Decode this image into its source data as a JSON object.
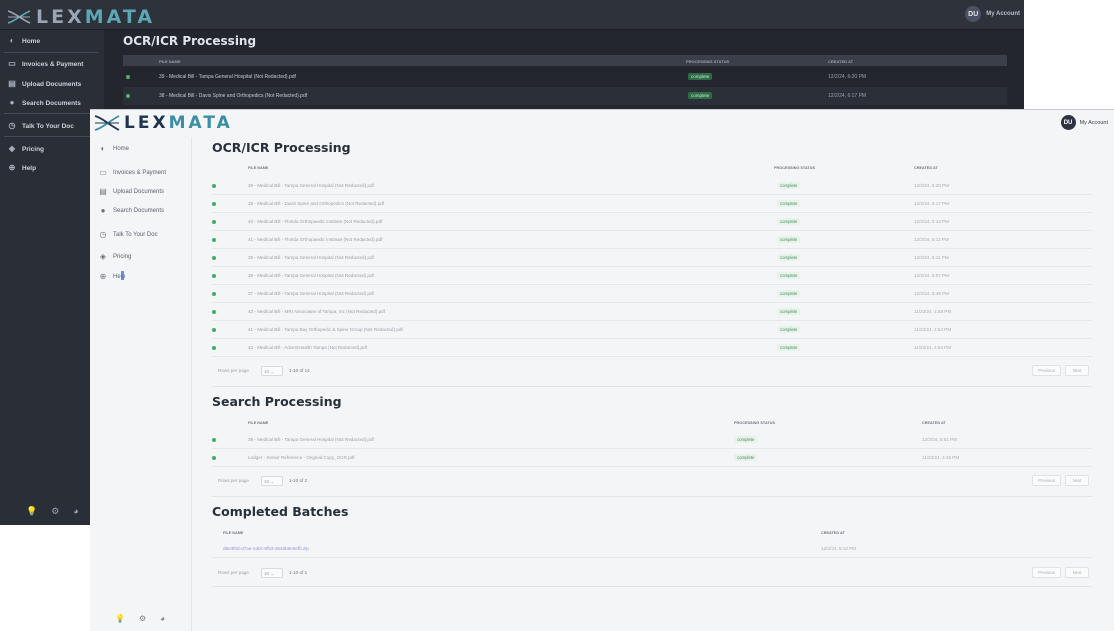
{
  "back": {
    "logo": {
      "prefix": "LEX",
      "accent": "MATA"
    },
    "account": {
      "initials": "DU",
      "label": "My Account"
    },
    "nav": [
      {
        "label": "Home",
        "icon": "◐"
      },
      {
        "label": "Invoices & Payment",
        "icon": "▭"
      },
      {
        "label": "Upload Documents",
        "icon": "▤"
      },
      {
        "label": "Search Documents",
        "icon": "●"
      },
      {
        "label": "Talk To Your Doc",
        "icon": "◷"
      },
      {
        "label": "Pricing",
        "icon": "◈"
      },
      {
        "label": "Help",
        "icon": "⊕"
      }
    ],
    "bottom_icons": [
      "💡",
      "⚙",
      "◕"
    ],
    "title": "OCR/ICR Processing",
    "columns": {
      "file_name": "FILE NAME",
      "status": "PROCESSING STATUS",
      "created": "CREATED AT"
    },
    "rows": [
      {
        "name": "39 - Medical Bill - Tampa General Hospital (Not Redacted).pdf",
        "status": "complete",
        "date": "12/2/24, 6:20 PM"
      },
      {
        "name": "38 - Medical Bill - Davis Spine and Orthopedics (Not Redacted).pdf",
        "status": "complete",
        "date": "12/2/24, 6:17 PM"
      }
    ]
  },
  "front": {
    "logo": {
      "prefix": "LEX",
      "accent": "MATA"
    },
    "account": {
      "initials": "DU",
      "label": "My Account"
    },
    "nav": [
      {
        "label": "Home",
        "icon": "◐"
      },
      {
        "label": "Invoices & Payment",
        "icon": "▭"
      },
      {
        "label": "Upload Documents",
        "icon": "▤"
      },
      {
        "label": "Search Documents",
        "icon": "●"
      },
      {
        "label": "Talk To Your Doc",
        "icon": "◷"
      },
      {
        "label": "Pricing",
        "icon": "◈"
      },
      {
        "label": "Help",
        "icon": "⊕"
      }
    ],
    "bottom_icons": [
      "💡",
      "⚙",
      "◕"
    ],
    "ocr": {
      "title": "OCR/ICR Processing",
      "columns": {
        "file_name": "FILE NAME",
        "status": "PROCESSING STATUS",
        "created": "CREATED AT"
      },
      "rows": [
        {
          "name": "39 - Medical Bill - Tampa General Hospital (Not Redacted).pdf",
          "status": "complete",
          "date": "12/2/24, 6:20 PM"
        },
        {
          "name": "38 - Medical Bill - Davis Spine and Orthopedics (Not Redacted).pdf",
          "status": "complete",
          "date": "12/2/24, 6:17 PM"
        },
        {
          "name": "40 - Medical Bill - Florida Orthopaedic Institute (Not Redacted).pdf",
          "status": "complete",
          "date": "12/2/24, 6:14 PM"
        },
        {
          "name": "41 - Medical Bill - Florida Orthopaedic Institute (Not Redacted).pdf",
          "status": "complete",
          "date": "12/2/24, 6:11 PM"
        },
        {
          "name": "35 - Medical Bill - Tampa General Hospital (Not Redacted).pdf",
          "status": "complete",
          "date": "12/2/24, 6:11 PM"
        },
        {
          "name": "39 - Medical Bill - Tampa General Hospital (Not Redacted).pdf",
          "status": "complete",
          "date": "12/2/24, 6:07 PM"
        },
        {
          "name": "37 - Medical Bill - Tampa General Hospital (Not Redacted).pdf",
          "status": "complete",
          "date": "12/2/24, 5:49 PM"
        },
        {
          "name": "42 - Medical Bill - MRI Associates of Tampa, Inc (Not Redacted).pdf",
          "status": "complete",
          "date": "11/22/24, 4:58 PM"
        },
        {
          "name": "41 - Medical Bill - Tampa Bay Orthopedic & Spine Group (Not Redacted).pdf",
          "status": "complete",
          "date": "11/22/24, 4:54 PM"
        },
        {
          "name": "43 - Medical Bill - AdventHealth Tampa (Not Redacted).pdf",
          "status": "complete",
          "date": "11/22/24, 4:54 PM"
        }
      ],
      "pager": {
        "rows_label": "Rows per page",
        "per_page": "10",
        "range": "1-10 of 14",
        "prev": "Previous",
        "next": "Next"
      }
    },
    "search": {
      "title": "Search Processing",
      "columns": {
        "file_name": "FILE NAME",
        "status": "PROCESSING STATUS",
        "created": "CREATED AT"
      },
      "rows": [
        {
          "name": "39 - Medical Bill - Tampa General Hospital (Not Redacted).pdf",
          "status": "complete",
          "date": "12/2/24, 5:51 PM"
        },
        {
          "name": "Ledger - Senior Reference - Original Copy_OCR.pdf",
          "status": "complete",
          "date": "11/22/24, 4:46 PM"
        }
      ],
      "pager": {
        "rows_label": "Rows per page",
        "per_page": "10",
        "range": "1-10 of 2",
        "prev": "Previous",
        "next": "Next"
      }
    },
    "batches": {
      "title": "Completed Batches",
      "columns": {
        "file_name": "FILE NAME",
        "created": "CREATED AT"
      },
      "rows": [
        {
          "name": "d8e3f0d-d7ae-4d0c-9f93-3548b8e0efb.zip",
          "date": "12/3/24, 5:12 PM"
        }
      ],
      "pager": {
        "rows_label": "Rows per page",
        "per_page": "10",
        "range": "1-10 of 1",
        "prev": "Previous",
        "next": "Next"
      }
    }
  }
}
